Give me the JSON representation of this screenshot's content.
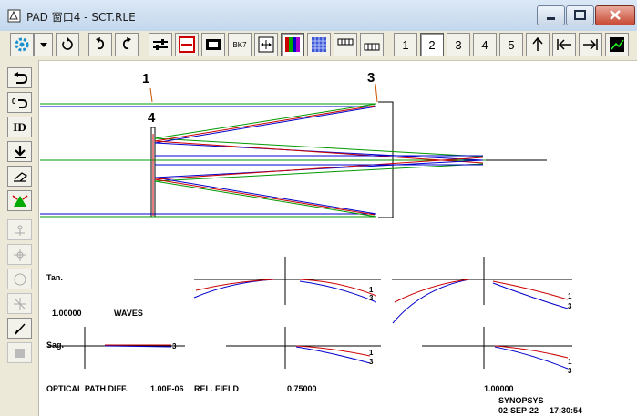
{
  "window": {
    "title": "PAD 窗口4 - SCT.RLE"
  },
  "toolbar": {
    "pages": [
      "1",
      "2",
      "3",
      "4",
      "5"
    ],
    "selected_page": "2",
    "glass_label": "BK7"
  },
  "sidebar": {
    "id_label": "ID"
  },
  "drawing": {
    "surface_labels": [
      "1",
      "4",
      "3"
    ]
  },
  "plot": {
    "tan_label": "Tan.",
    "sag_label": "Sag.",
    "scale_value": "1.00000",
    "scale_unit": "WAVES",
    "footer_title": "OPTICAL PATH DIFF.",
    "footer_wavelength": "1.00E-06",
    "footer_field_label": "REL. FIELD",
    "field_values": [
      "0.75000",
      "1.00000"
    ],
    "curve_labels": {
      "one": "1",
      "three": "3"
    },
    "curve_colors": {
      "primary": "#0000cc",
      "secondary": "#cc0000",
      "tertiary": "#009900"
    }
  },
  "branding": {
    "name": "SYNOPSYS",
    "date": "02-SEP-22",
    "time": "17:30:54"
  }
}
